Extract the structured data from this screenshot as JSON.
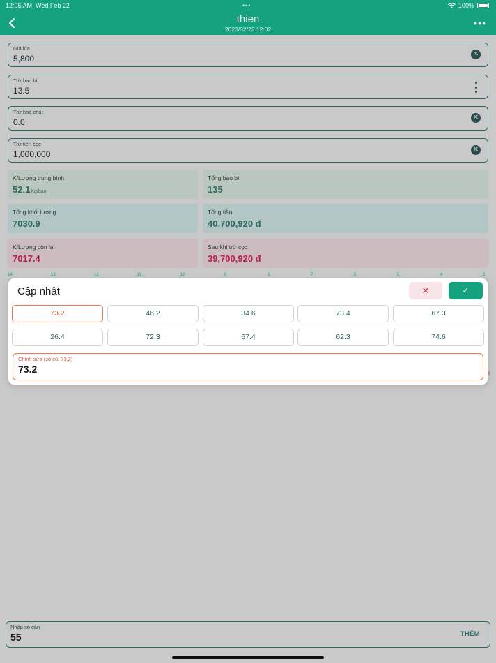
{
  "status_bar": {
    "time": "12:06 AM",
    "date": "Wed Feb 22",
    "battery": "100%",
    "multitask_dots": "•••"
  },
  "header": {
    "title": "thien",
    "subtitle": "2023/02/22 12:02",
    "more_label": "•••"
  },
  "fields": [
    {
      "label": "Giá lúa",
      "value": "5,800"
    },
    {
      "label": "Trừ bao bì",
      "value": "13.5"
    },
    {
      "label": "Trừ hoá chất",
      "value": "0.0"
    },
    {
      "label": "Trừ tiền cọc",
      "value": "1,000,000"
    }
  ],
  "stats": [
    {
      "label": "K/Lượng trung bình",
      "value": "52.1",
      "unit": "Kg/bao"
    },
    {
      "label": "Tổng bao bì",
      "value": "135"
    },
    {
      "label": "Tổng khối lượng",
      "value": "7030.9"
    },
    {
      "label": "Tổng tiền",
      "value": "40,700,920 đ"
    },
    {
      "label": "K/Lượng còn lại",
      "value": "7017.4"
    },
    {
      "label": "Sau khi trừ cọc",
      "value": "39,700,920 đ"
    }
  ],
  "ticks": [
    "14",
    "13",
    "12",
    "11",
    "10",
    "9",
    "8",
    "7",
    "6",
    "5",
    "4",
    "3"
  ],
  "modal": {
    "title": "Cập nhật",
    "cancel_label": "✕",
    "confirm_label": "✓",
    "options": [
      "73.2",
      "46.2",
      "34.6",
      "73.4",
      "67.3",
      "26.4",
      "72.3",
      "67.4",
      "62.3",
      "74.6"
    ],
    "selected": "73.2",
    "edit_label": "Chỉnh sửa (số cũ:  73.2)",
    "edit_value": "73.2"
  },
  "edge_mark": "t",
  "bottom": {
    "label": "Nhập số cân",
    "value": "55",
    "add_label": "THÊM"
  },
  "colors": {
    "brand": "#14a27f",
    "accent_red": "#b81d4b",
    "selection": "#e67452"
  }
}
